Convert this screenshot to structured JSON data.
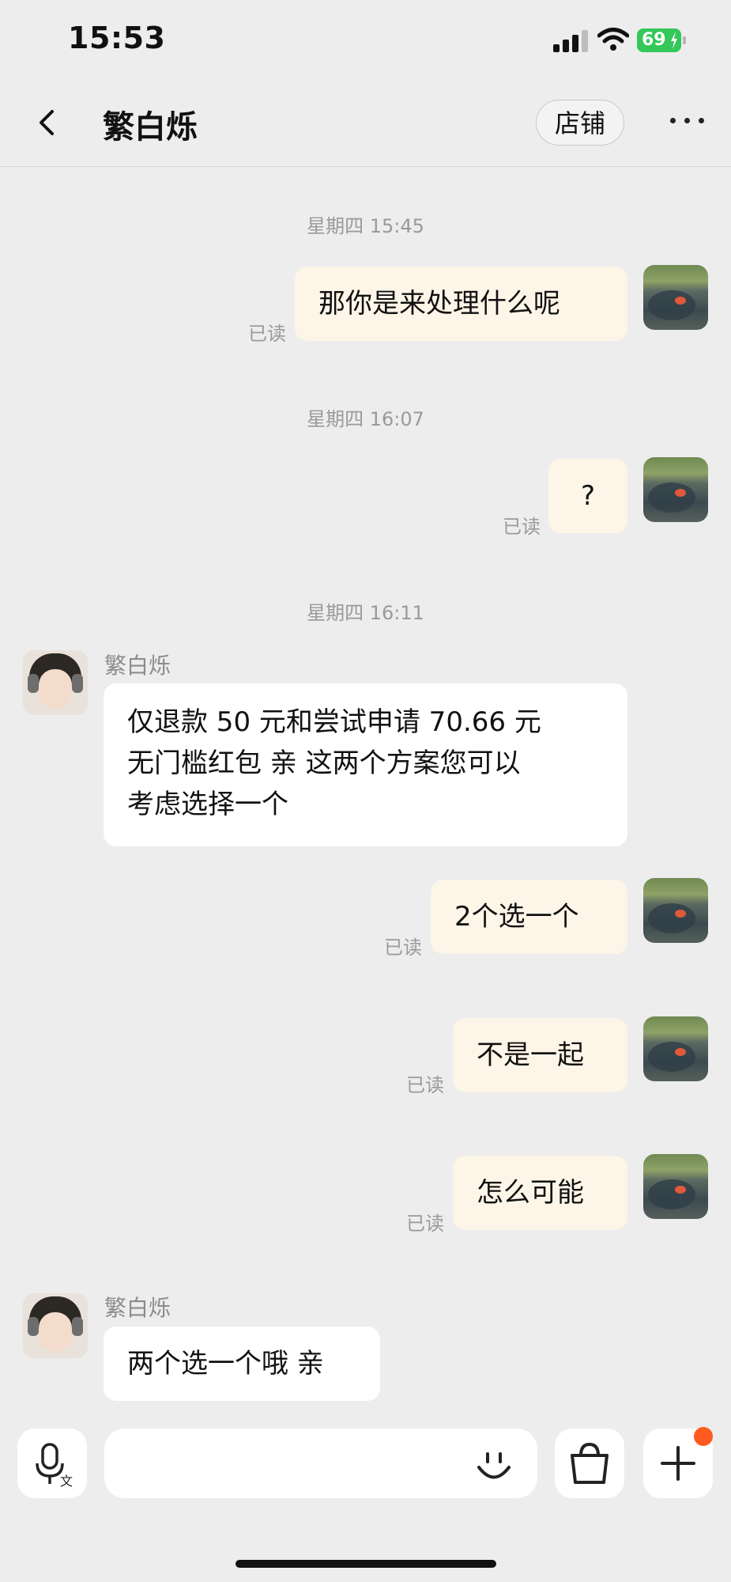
{
  "status_bar": {
    "time": "15:53",
    "battery": "69"
  },
  "header": {
    "back_icon": "chevron-left-icon",
    "title": "繁白烁",
    "shop_button": "店铺",
    "more_icon": "more-dots-icon"
  },
  "timestamps": [
    "星期四 15:45",
    "星期四 16:07",
    "星期四 16:11"
  ],
  "messages": [
    {
      "from": "me",
      "text": "那你是来处理什么呢",
      "status": "已读"
    },
    {
      "from": "me",
      "text": "?",
      "status": "已读"
    },
    {
      "from": "them",
      "sender": "繁白烁",
      "lines": [
        "仅退款 50 元和尝试申请 70.66 元",
        "无门槛红包 亲 这两个方案您可以",
        "考虑选择一个"
      ]
    },
    {
      "from": "me",
      "text": "2个选一个",
      "status": "已读"
    },
    {
      "from": "me",
      "text": "不是一起",
      "status": "已读"
    },
    {
      "from": "me",
      "text": "怎么可能",
      "status": "已读"
    },
    {
      "from": "them",
      "sender": "繁白烁",
      "text": "两个选一个哦 亲"
    }
  ],
  "input_bar": {
    "voice_icon": "voice-translate-icon",
    "input_value": "",
    "emoji_icon": "emoji-icon",
    "shop_icon": "shopping-bag-icon",
    "add_icon": "plus-icon",
    "badge_color": "#ff5a1f"
  },
  "colors": {
    "my_bubble": "#fdf5e7",
    "their_bubble": "#ffffff",
    "background": "#ededed",
    "battery": "#34c759"
  }
}
